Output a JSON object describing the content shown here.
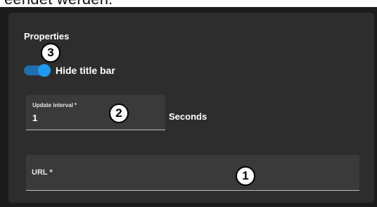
{
  "top_text": "eendet werden.",
  "properties": {
    "heading": "Properties"
  },
  "hide_title_bar": {
    "label": "Hide title bar",
    "enabled": true
  },
  "update_interval": {
    "label": "Update interval *",
    "value": "1",
    "unit": "Seconds"
  },
  "url": {
    "label": "URL *",
    "value": ""
  },
  "callouts": {
    "one": "1",
    "two": "2",
    "three": "3"
  },
  "colors": {
    "panel_bg": "#2d2d2d",
    "outer_bg": "#1b1b1b",
    "field_bg": "#3a3a3a",
    "toggle_accent": "#1e9bf0"
  }
}
